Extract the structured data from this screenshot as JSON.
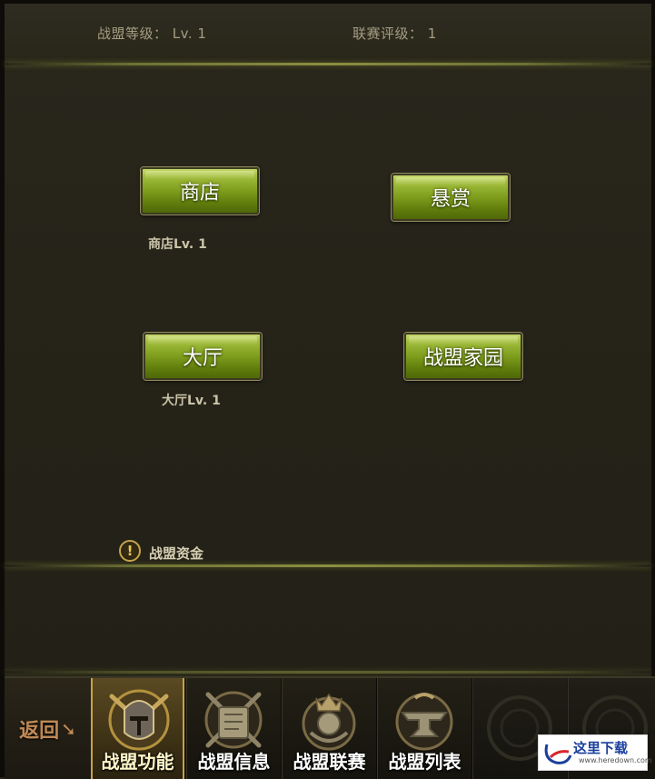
{
  "header": {
    "alliance_level": "战盟等级： Lv. 1",
    "league_rating": "联赛评级： 1"
  },
  "functions": [
    {
      "label": "商店",
      "level": "商店Lv. 1"
    },
    {
      "label": "悬赏",
      "level": ""
    },
    {
      "label": "大厅",
      "level": "大厅Lv. 1"
    },
    {
      "label": "战盟家园",
      "level": ""
    }
  ],
  "fund": {
    "icon": "exclamation-icon",
    "label": "战盟资金"
  },
  "bottom_nav": {
    "back_label": "返回",
    "tabs": [
      {
        "label": "战盟功能",
        "icon": "knight-helmet-emblem",
        "active": true
      },
      {
        "label": "战盟信息",
        "icon": "scroll-swords-emblem",
        "active": false
      },
      {
        "label": "战盟联赛",
        "icon": "crowned-warrior-emblem",
        "active": false
      },
      {
        "label": "战盟列表",
        "icon": "anvil-emblem",
        "active": false
      }
    ]
  },
  "watermark": {
    "text": "这里下载",
    "url": "www.heredown.com"
  },
  "colors": {
    "button_green": "#7e9d1d",
    "active_tab_gold": "#c9a244",
    "panel_bg": "#25231a"
  }
}
